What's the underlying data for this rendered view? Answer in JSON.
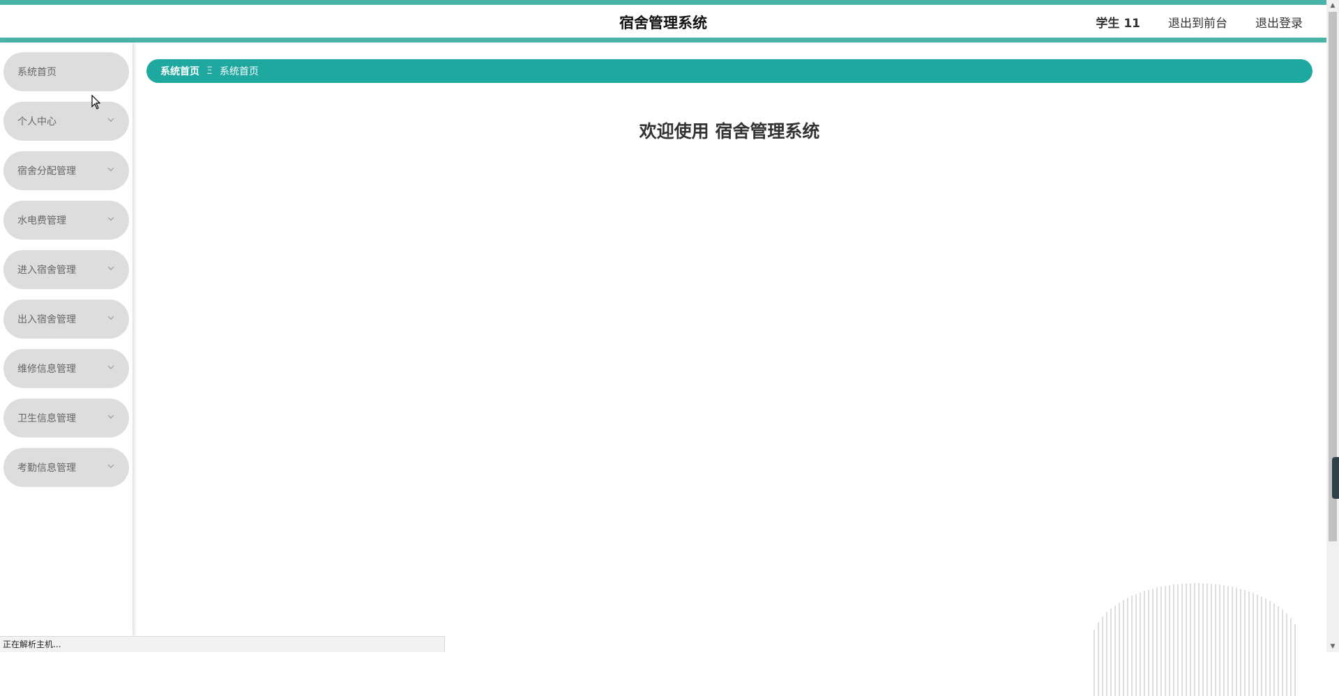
{
  "header": {
    "title": "宿舍管理系统",
    "user_label": "学生 11",
    "back_to_front_label": "退出到前台",
    "logout_label": "退出登录"
  },
  "sidebar": {
    "items": [
      {
        "label": "系统首页",
        "has_submenu": false
      },
      {
        "label": "个人中心",
        "has_submenu": true
      },
      {
        "label": "宿舍分配管理",
        "has_submenu": true
      },
      {
        "label": "水电费管理",
        "has_submenu": true
      },
      {
        "label": "进入宿舍管理",
        "has_submenu": true
      },
      {
        "label": "出入宿舍管理",
        "has_submenu": true
      },
      {
        "label": "维修信息管理",
        "has_submenu": true
      },
      {
        "label": "卫生信息管理",
        "has_submenu": true
      },
      {
        "label": "考勤信息管理",
        "has_submenu": true
      }
    ]
  },
  "breadcrumb": {
    "home_label": "系统首页",
    "separator": "Ξ",
    "current_label": "系统首页"
  },
  "main": {
    "welcome_text": "欢迎使用 宿舍管理系统"
  },
  "status_bar": {
    "text": "正在解析主机..."
  },
  "colors": {
    "accent": "#49b3a7",
    "breadcrumb_bg": "#1ea8a0",
    "menu_item_bg": "#dddddd"
  },
  "icons": {
    "chevron": "chevron-down-icon",
    "scroll_up": "scroll-up-icon",
    "scroll_down": "scroll-down-icon"
  }
}
